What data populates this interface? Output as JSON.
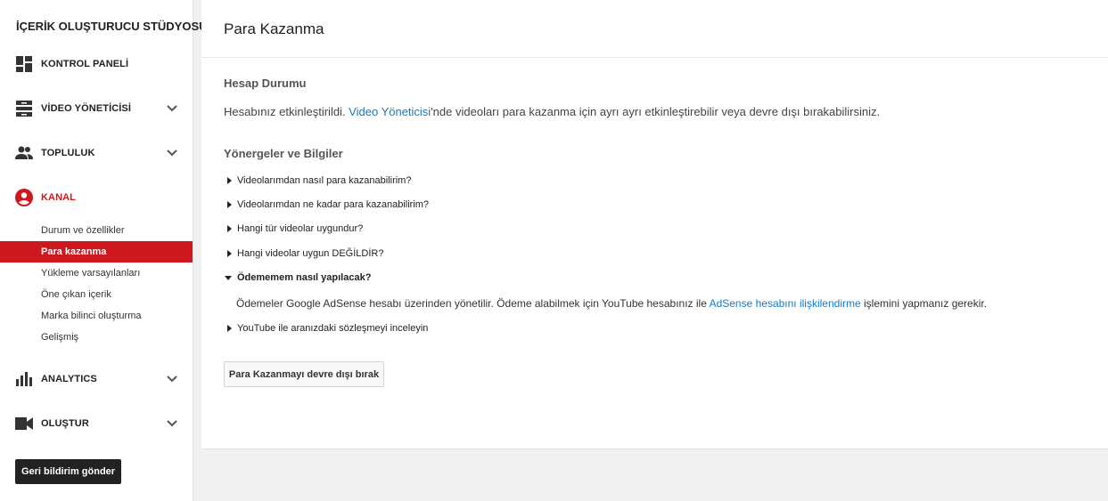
{
  "sidebar": {
    "studio_title": "İÇERİK OLUŞTURUCU STÜDYOSU",
    "nav": {
      "dashboard": "KONTROL PANELİ",
      "video_manager": "VİDEO YÖNETİCİSİ",
      "community": "TOPLULUK",
      "channel": "KANAL",
      "analytics": "ANALYTICS",
      "create": "OLUŞTUR"
    },
    "channel_sub": {
      "status": "Durum ve özellikler",
      "monetization": "Para kazanma",
      "upload_defaults": "Yükleme varsayılanları",
      "featured": "Öne çıkan içerik",
      "branding": "Marka bilinci oluşturma",
      "advanced": "Gelişmiş"
    },
    "feedback_button": "Geri bildirim gönder",
    "accent_color": "#cc181e"
  },
  "main": {
    "page_title": "Para Kazanma",
    "account_status": {
      "heading": "Hesap Durumu",
      "text_before": "Hesabınız etkinleştirildi. ",
      "link": "Video Yöneticisi",
      "text_after": "'nde videoları para kazanma için ayrı ayrı etkinleştirebilir veya devre dışı bırakabilirsiniz."
    },
    "guidelines": {
      "heading": "Yönergeler ve Bilgiler",
      "q1": "Videolarımdan nasıl para kazanabilirim?",
      "q2": "Videolarımdan ne kadar para kazanabilirim?",
      "q3": "Hangi tür videolar uygundur?",
      "q4": "Hangi videolar uygun DEĞİLDİR?",
      "q5": "Ödememem nasıl yapılacak?",
      "q6": "YouTube ile aranızdaki sözleşmeyi inceleyin",
      "answer_before": "Ödemeler Google AdSense hesabı üzerinden yönetilir. Ödeme alabilmek için YouTube hesabınız ile ",
      "answer_link": "AdSense hesabını ilişkilendirme",
      "answer_after": " işlemini yapmanız gerekir."
    },
    "disable_button": "Para Kazanmayı devre dışı bırak",
    "link_color": "#167ac6"
  }
}
